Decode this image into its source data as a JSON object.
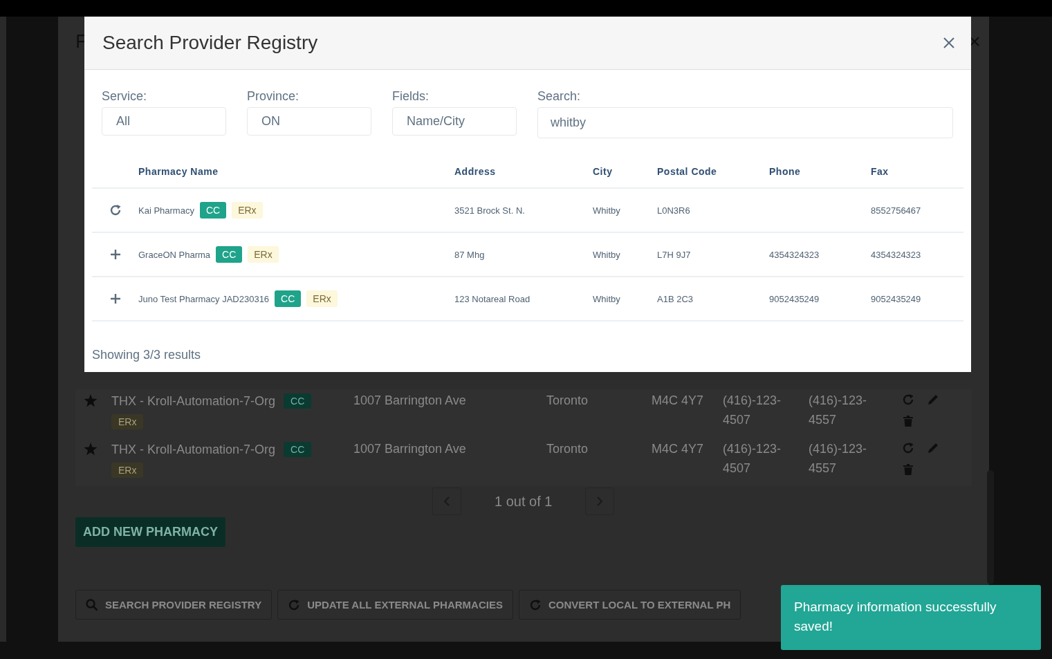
{
  "background_dialog": {
    "title": "F",
    "rows": [
      {
        "name": "THX - Kroll-Automation-7-Org",
        "badges": [
          {
            "label": "CC",
            "kind": "cc"
          },
          {
            "label": "ERx",
            "kind": "erx"
          }
        ],
        "address": "1007 Barrington Ave",
        "city": "Toronto",
        "postal_code": "M4C 4Y7",
        "phone": "(416)-123-4507",
        "fax": "(416)-123-4557"
      },
      {
        "name": "THX - Kroll-Automation-7-Org",
        "badges": [
          {
            "label": "CC",
            "kind": "cc"
          },
          {
            "label": "ERx",
            "kind": "erx"
          }
        ],
        "address": "1007 Barrington Ave",
        "city": "Toronto",
        "postal_code": "M4C 4Y7",
        "phone": "(416)-123-4507",
        "fax": "(416)-123-4557"
      }
    ],
    "pagination": {
      "label": "1 out of 1"
    },
    "add_button": "ADD NEW PHARMACY",
    "actions": [
      {
        "label": "SEARCH PROVIDER REGISTRY",
        "kind": "search"
      },
      {
        "label": "UPDATE ALL EXTERNAL PHARMACIES",
        "kind": "refresh"
      },
      {
        "label": "CONVERT LOCAL TO EXTERNAL PH",
        "kind": "refresh"
      }
    ]
  },
  "modal": {
    "title": "Search Provider Registry",
    "filters": [
      {
        "label": "Service:",
        "value": "All",
        "kind": "select"
      },
      {
        "label": "Province:",
        "value": "ON",
        "kind": "select"
      },
      {
        "label": "Fields:",
        "value": "Name/City",
        "kind": "select"
      },
      {
        "label": "Search:",
        "value": "whitby",
        "kind": "text"
      }
    ],
    "table": {
      "columns": [
        "Pharmacy Name",
        "Address",
        "City",
        "Postal Code",
        "Phone",
        "Fax"
      ],
      "rows": [
        {
          "kind": "refresh",
          "name": "Kai Pharmacy",
          "badges": [
            {
              "label": "CC",
              "kind": "cc"
            },
            {
              "label": "ERx",
              "kind": "erx"
            }
          ],
          "address": "3521 Brock St. N.",
          "city": "Whitby",
          "postal_code": "L0N3R6",
          "fax": "8552756467"
        },
        {
          "kind": "add",
          "name": "GraceON Pharma",
          "badges": [
            {
              "label": "CC",
              "kind": "cc"
            },
            {
              "label": "ERx",
              "kind": "erx"
            }
          ],
          "address": "87 Mhg",
          "city": "Whitby",
          "postal_code": "L7H 9J7",
          "phone": "4354324323",
          "fax": "4354324323"
        },
        {
          "kind": "add",
          "name": "Juno Test Pharmacy JAD230316",
          "badges": [
            {
              "label": "CC",
              "kind": "cc"
            },
            {
              "label": "ERx",
              "kind": "erx"
            }
          ],
          "address": "123 Notareal Road",
          "city": "Whitby",
          "postal_code": "A1B 2C3",
          "phone": "9052435249",
          "fax": "9052435249"
        }
      ]
    },
    "footer": "Showing 3/3 results"
  },
  "toast": {
    "message": "Pharmacy information successfully saved!"
  }
}
